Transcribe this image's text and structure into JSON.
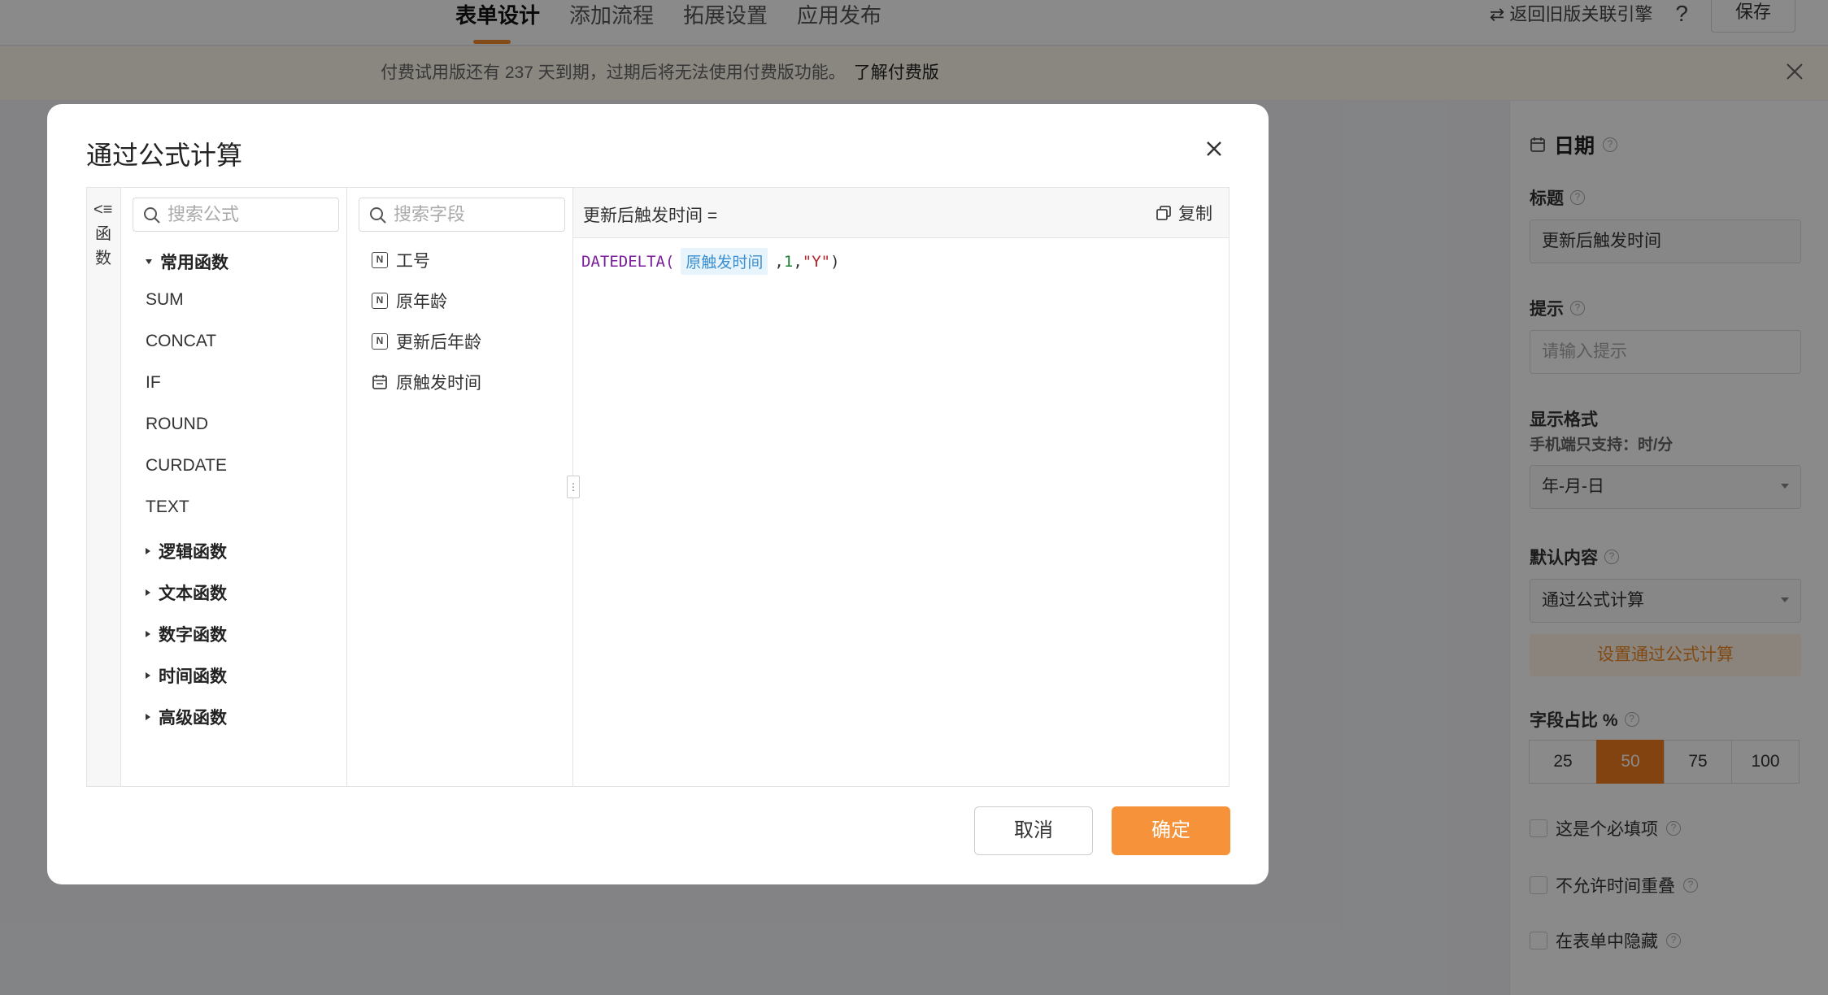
{
  "topnav": {
    "tabs": [
      "表单设计",
      "添加流程",
      "拓展设置",
      "应用发布"
    ],
    "active_tab": "表单设计",
    "old_version_link": "⇄ 返回旧版关联引擎",
    "help": "?",
    "save_label": "保存"
  },
  "banner": {
    "message": "付费试用版还有 237 天到期，过期后将无法使用付费版功能。",
    "link": "了解付费版"
  },
  "right_panel": {
    "field_type": "日期",
    "title_label": "标题",
    "title_value": "更新后触发时间",
    "hint_label": "提示",
    "hint_placeholder": "请输入提示",
    "format_label": "显示格式",
    "format_note": "手机端只支持：时/分",
    "format_value": "年-月-日",
    "default_label": "默认内容",
    "default_value": "通过公式计算",
    "formula_link": "设置通过公式计算",
    "width_label": "字段占比 %",
    "width_options": [
      "25",
      "50",
      "75",
      "100"
    ],
    "width_selected": "50",
    "checkboxes": [
      "这是个必填项",
      "不允许时间重叠",
      "在表单中隐藏"
    ]
  },
  "modal": {
    "title": "通过公式计算",
    "collapse_icon": "<≡",
    "collapse_label": "函数",
    "func_search_placeholder": "搜索公式",
    "field_search_placeholder": "搜索字段",
    "common_group": "常用函数",
    "common_functions": [
      "SUM",
      "CONCAT",
      "IF",
      "ROUND",
      "CURDATE",
      "TEXT"
    ],
    "other_groups": [
      "逻辑函数",
      "文本函数",
      "数字函数",
      "时间函数",
      "高级函数"
    ],
    "fields": [
      {
        "icon": "N",
        "label": "工号"
      },
      {
        "icon": "N",
        "label": "原年龄"
      },
      {
        "icon": "N",
        "label": "更新后年龄"
      },
      {
        "icon": "calendar",
        "label": "原触发时间"
      }
    ],
    "target_field": "更新后触发时间 =",
    "copy_label": "复制",
    "formula": {
      "func": "DATEDELTA(",
      "field_tag": "原触发时间",
      "arg_comma": ",",
      "number": "1",
      "comma2": ",",
      "string": "\"Y\"",
      "close": ")"
    },
    "cancel_label": "取消",
    "ok_label": "确定"
  },
  "colors": {
    "accent": "#f5923a",
    "selected_segment": "#f07c1e",
    "overlay": "rgba(0,0,0,0.46)"
  }
}
